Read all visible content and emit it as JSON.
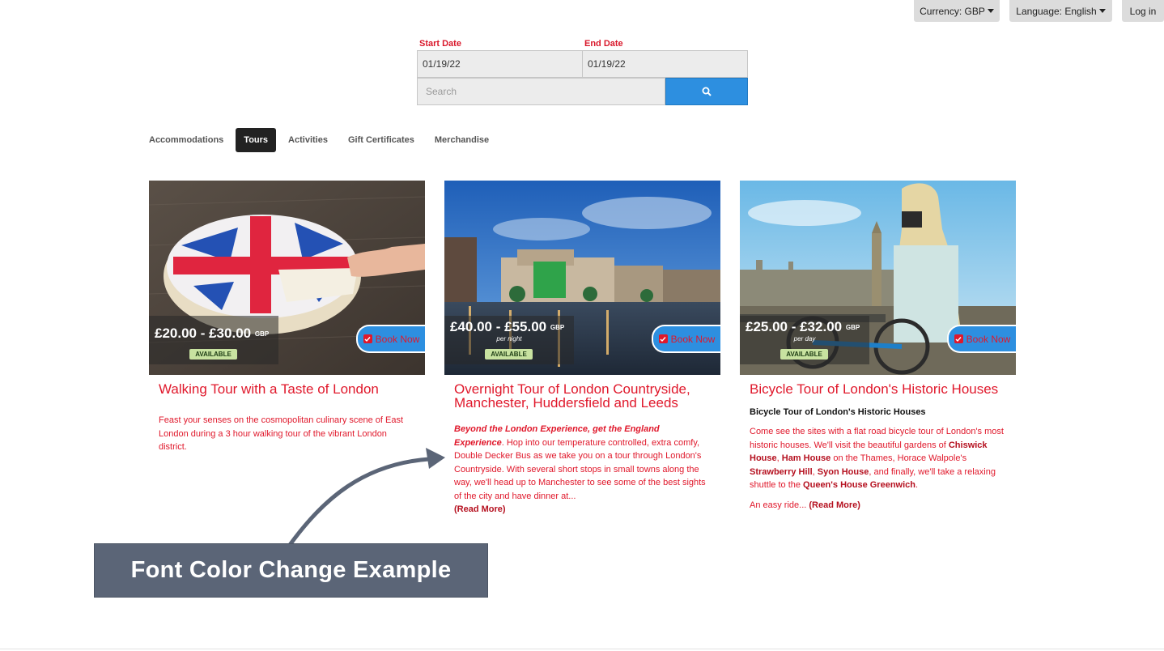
{
  "header": {
    "currency_label": "Currency: GBP",
    "language_label": "Language: English",
    "login_label": "Log in"
  },
  "search": {
    "start_label": "Start Date",
    "start_value": "01/19/22",
    "end_label": "End Date",
    "end_value": "01/19/22",
    "placeholder": "Search"
  },
  "tabs": [
    "Accommodations",
    "Tours",
    "Activities",
    "Gift Certificates",
    "Merchandise"
  ],
  "active_tab": "Tours",
  "cards": [
    {
      "price": "£20.00 - £30.00",
      "currency": "GBP",
      "per": "",
      "status": "AVAILABLE",
      "book_label": "Book Now",
      "title": "Walking Tour with a Taste of London",
      "desc": "Feast your senses on the cosmopolitan culinary scene of East London during a 3 hour walking tour of the vibrant London district."
    },
    {
      "price": "£40.00 - £55.00",
      "currency": "GBP",
      "per": "per night",
      "status": "AVAILABLE",
      "book_label": "Book Now",
      "title": "Overnight Tour of London Countryside, Manchester, Huddersfield and Leeds",
      "desc_em": "Beyond the London Experience, get the England Experience",
      "desc": ". Hop into our temperature controlled, extra comfy, Double Decker Bus as we take you on a tour through London's Countryside. With several short stops in small towns along the way, we'll head up to Manchester to see some of the best sights of the city and have dinner at...",
      "read_more": "(Read More)"
    },
    {
      "price": "£25.00 - £32.00",
      "currency": "GBP",
      "per": "per day",
      "status": "AVAILABLE",
      "book_label": "Book Now",
      "title": "Bicycle Tour of London's Historic Houses",
      "subtitle": "Bicycle Tour of London's Historic Houses",
      "desc_parts": {
        "p1": "Come see the sites with a flat road bicycle tour of London's most historic houses. We'll visit the beautiful gardens of ",
        "b1": "Chiswick House",
        "p2": ", ",
        "b2": "Ham House",
        "p3": " on the Thames, Horace Walpole's ",
        "b3": "Strawberry Hill",
        "p4": ", ",
        "b4": "Syon House",
        "p5": ", and finally, we'll take a relaxing shuttle to the ",
        "b5": "Queen's House Greenwich",
        "p6": "."
      },
      "desc2": "An easy ride... ",
      "read_more": "(Read More)"
    }
  ],
  "annotation": "Font Color Change Example",
  "colors": {
    "accent_red": "#e0182b",
    "button_blue": "#2d8fe0",
    "banner_bg": "#5b6577"
  },
  "icons": [
    "search-icon",
    "caret-down-icon",
    "checkbox-icon"
  ]
}
